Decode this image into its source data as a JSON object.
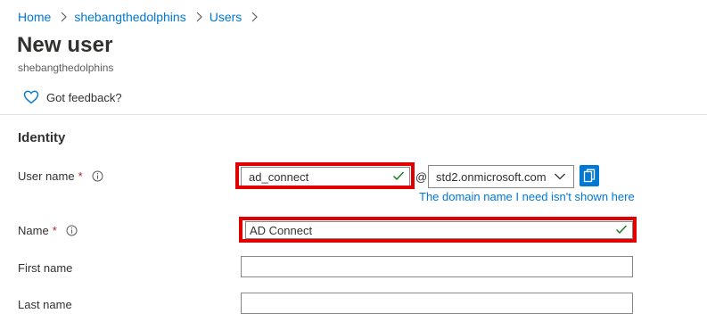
{
  "breadcrumb": {
    "items": [
      "Home",
      "shebangthedolphins",
      "Users"
    ]
  },
  "page": {
    "title": "New user",
    "subtitle": "shebangthedolphins"
  },
  "feedback": {
    "label": "Got feedback?"
  },
  "identity": {
    "section_title": "Identity",
    "user_name": {
      "label": "User name",
      "required_mark": "*",
      "value": "ad_connect",
      "at": "@",
      "domain": "std2.onmicrosoft.com",
      "domain_link": "The domain name I need isn't shown here"
    },
    "name": {
      "label": "Name",
      "required_mark": "*",
      "value": "AD Connect"
    },
    "first_name": {
      "label": "First name",
      "value": ""
    },
    "last_name": {
      "label": "Last name",
      "value": ""
    }
  },
  "colors": {
    "accent": "#0078d4",
    "highlight": "#e00000",
    "valid": "#107c10",
    "required": "#a4262c"
  },
  "icons": {
    "separator": "chevron-right-icon",
    "feedback": "heart-icon",
    "info": "info-icon",
    "valid": "checkmark-icon",
    "dropdown": "chevron-down-icon",
    "copy": "copy-icon"
  }
}
